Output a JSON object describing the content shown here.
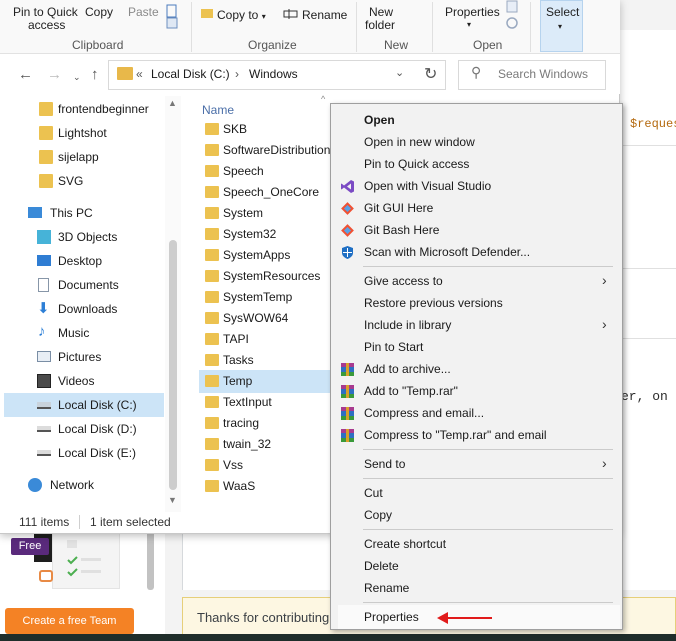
{
  "background": {
    "code_line": "$reques",
    "code_line2": "er, on",
    "thanks_text": "Thanks for contributing",
    "free_badge": "Free",
    "team_button": "Create a free Team"
  },
  "ribbon": {
    "pin_quick_access": "Pin to Quick access",
    "pin_quick_access_l1": "Pin to Quick",
    "pin_quick_access_l2": "access",
    "copy": "Copy",
    "paste": "Paste",
    "copy_to": "Copy to",
    "rename": "Rename",
    "new_folder_l1": "New",
    "new_folder_l2": "folder",
    "properties": "Properties",
    "select": "Select",
    "groups": {
      "clipboard": "Clipboard",
      "organize": "Organize",
      "new": "New",
      "open": "Open"
    }
  },
  "address": {
    "chevron": "«",
    "segment1": "Local Disk (C:)",
    "separator": "›",
    "segment2": "Windows"
  },
  "search": {
    "placeholder": "Search Windows"
  },
  "nav_pane": {
    "quick_access": [
      "frontendbeginner",
      "Lightshot",
      "sijelapp",
      "SVG"
    ],
    "this_pc": "This PC",
    "this_pc_items": [
      "3D Objects",
      "Desktop",
      "Documents",
      "Downloads",
      "Music",
      "Pictures",
      "Videos"
    ],
    "drives": [
      "Local Disk (C:)",
      "Local Disk (D:)",
      "Local Disk (E:)"
    ],
    "network": "Network"
  },
  "file_list": {
    "column_name": "Name",
    "items": [
      "SKB",
      "SoftwareDistribution",
      "Speech",
      "Speech_OneCore",
      "System",
      "System32",
      "SystemApps",
      "SystemResources",
      "SystemTemp",
      "SysWOW64",
      "TAPI",
      "Tasks",
      "Temp",
      "TextInput",
      "tracing",
      "twain_32",
      "Vss",
      "WaaS"
    ],
    "selected": "Temp"
  },
  "status_bar": {
    "count": "111 items",
    "selection": "1 item selected"
  },
  "context_menu": {
    "open": "Open",
    "open_new_window": "Open in new window",
    "pin_quick_access": "Pin to Quick access",
    "open_visual_studio": "Open with Visual Studio",
    "git_gui": "Git GUI Here",
    "git_bash": "Git Bash Here",
    "scan_defender": "Scan with Microsoft Defender...",
    "give_access": "Give access to",
    "restore_versions": "Restore previous versions",
    "include_library": "Include in library",
    "pin_start": "Pin to Start",
    "add_archive": "Add to archive...",
    "add_temp_rar": "Add to \"Temp.rar\"",
    "compress_email": "Compress and email...",
    "compress_temp_email": "Compress to \"Temp.rar\" and email",
    "send_to": "Send to",
    "cut": "Cut",
    "copy": "Copy",
    "create_shortcut": "Create shortcut",
    "delete": "Delete",
    "rename": "Rename",
    "properties": "Properties"
  },
  "colors": {
    "accent_selection": "#cce4f7",
    "folder": "#ecc250",
    "annotation_arrow": "#e11b1b",
    "orange_button": "#f48225"
  }
}
